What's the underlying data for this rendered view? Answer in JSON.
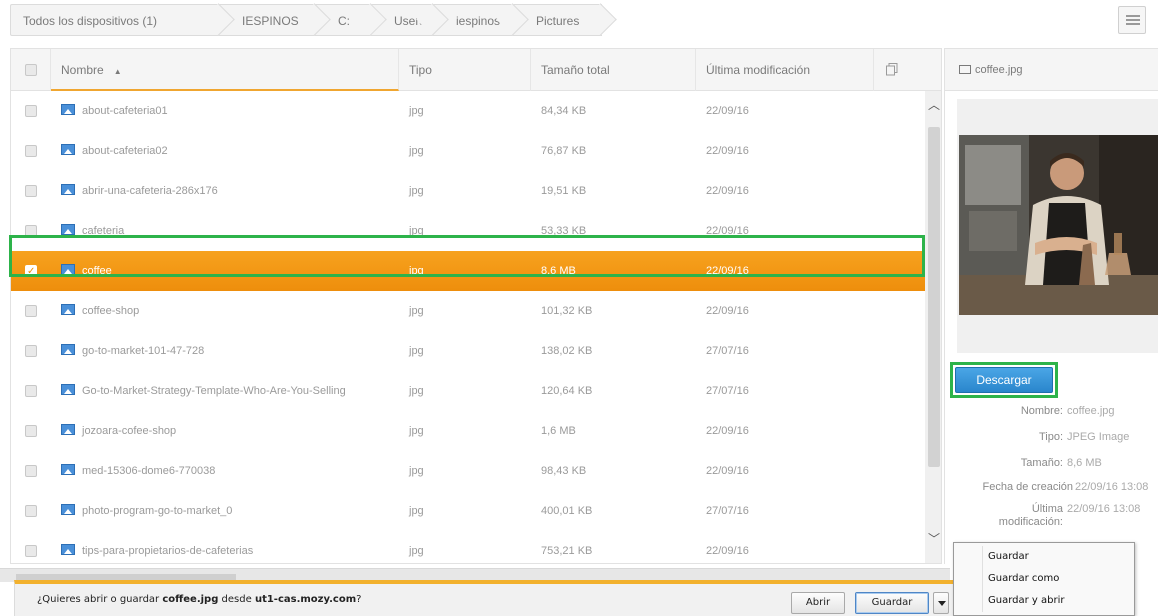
{
  "breadcrumb": [
    "Todos los dispositivos (1)",
    "IESPINOS",
    "C:",
    "Users",
    "iespinos",
    "Pictures"
  ],
  "table": {
    "columns": {
      "name": "Nombre",
      "type": "Tipo",
      "size": "Tamaño total",
      "modified": "Última modificación"
    },
    "rows": [
      {
        "name": "about-cafeteria01",
        "type": "jpg",
        "size": "84,34 KB",
        "modified": "22/09/16"
      },
      {
        "name": "about-cafeteria02",
        "type": "jpg",
        "size": "76,87 KB",
        "modified": "22/09/16"
      },
      {
        "name": "abrir-una-cafeteria-286x176",
        "type": "jpg",
        "size": "19,51 KB",
        "modified": "22/09/16"
      },
      {
        "name": "cafeteria",
        "type": "jpg",
        "size": "53,33 KB",
        "modified": "22/09/16"
      },
      {
        "name": "coffee",
        "type": "jpg",
        "size": "8,6 MB",
        "modified": "22/09/16",
        "selected": true
      },
      {
        "name": "coffee-shop",
        "type": "jpg",
        "size": "101,32 KB",
        "modified": "22/09/16"
      },
      {
        "name": "go-to-market-101-47-728",
        "type": "jpg",
        "size": "138,02 KB",
        "modified": "27/07/16"
      },
      {
        "name": "Go-to-Market-Strategy-Template-Who-Are-You-Selling",
        "type": "jpg",
        "size": "120,64 KB",
        "modified": "27/07/16"
      },
      {
        "name": "jozoara-cofee-shop",
        "type": "jpg",
        "size": "1,6 MB",
        "modified": "22/09/16"
      },
      {
        "name": "med-15306-dome6-770038",
        "type": "jpg",
        "size": "98,43 KB",
        "modified": "22/09/16"
      },
      {
        "name": "photo-program-go-to-market_0",
        "type": "jpg",
        "size": "400,01 KB",
        "modified": "27/07/16"
      },
      {
        "name": "tips-para-propietarios-de-cafeterias",
        "type": "jpg",
        "size": "753,21 KB",
        "modified": "22/09/16"
      }
    ]
  },
  "preview": {
    "filename": "coffee.jpg",
    "download_label": "Descargar",
    "meta": [
      {
        "label": "Nombre:",
        "value": "coffee.jpg"
      },
      {
        "label": "Tipo:",
        "value": "JPEG Image"
      },
      {
        "label": "Tamaño:",
        "value": "8,6 MB"
      },
      {
        "label": "Fecha de creación",
        "value": "22/09/16 13:08"
      },
      {
        "label": "Última modificación:",
        "value": "22/09/16 13:08"
      }
    ]
  },
  "download_bar": {
    "prefix": "¿Quieres abrir o guardar ",
    "file": "coffee.jpg",
    "middle": " desde ",
    "host": "ut1-cas.mozy.com",
    "suffix": "?",
    "open_label": "Abrir",
    "save_label": "Guardar"
  },
  "save_menu": [
    "Guardar",
    "Guardar como",
    "Guardar y abrir"
  ],
  "colors": {
    "selected_row": "#f29a17",
    "highlight_outline": "#2db34a",
    "download_button": "#3a96da"
  }
}
